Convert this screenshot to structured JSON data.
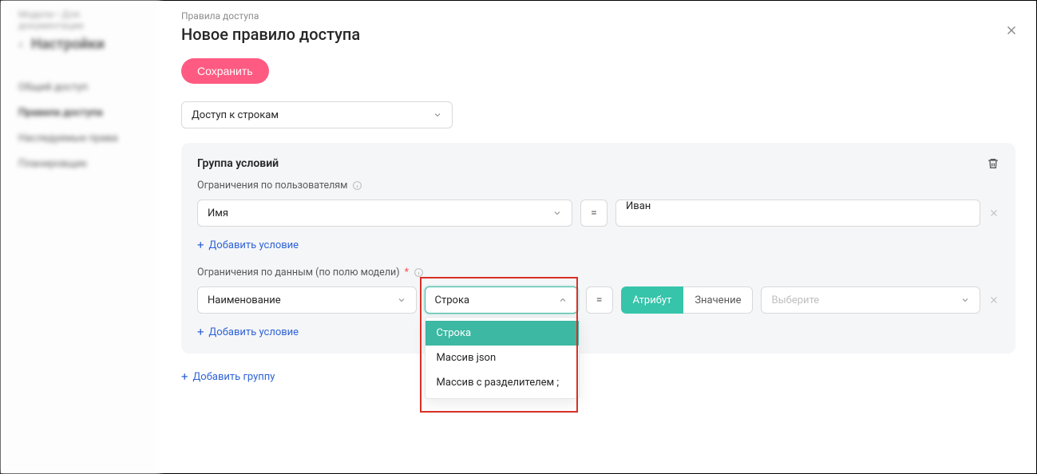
{
  "bg": {
    "breadcrumb": "Модели  •  Для документации",
    "title": "Настройки",
    "nav": [
      "Общий доступ",
      "Правила доступа",
      "Наследуемые права",
      "Планировщик"
    ],
    "nav_active_index": 1
  },
  "panel": {
    "crumb": "Правила доступа",
    "title": "Новое правило доступа",
    "save_label": "Сохранить",
    "access_type_value": "Доступ к строкам"
  },
  "group": {
    "title": "Группа условий",
    "user_section_label": "Ограничения по пользователям",
    "cond1": {
      "field": "Имя",
      "op": "=",
      "value": "Иван"
    },
    "add_condition_label": "Добавить условие",
    "data_section_label": "Ограничения по данным (по полю модели)",
    "cond2": {
      "field": "Наименование",
      "type_value": "Строка",
      "op": "=",
      "seg_attr": "Атрибут",
      "seg_val": "Значение",
      "choose_placeholder": "Выберите"
    },
    "type_options": [
      "Строка",
      "Массив json",
      "Массив с разделителем ;"
    ]
  },
  "add_group_label": "Добавить группу"
}
